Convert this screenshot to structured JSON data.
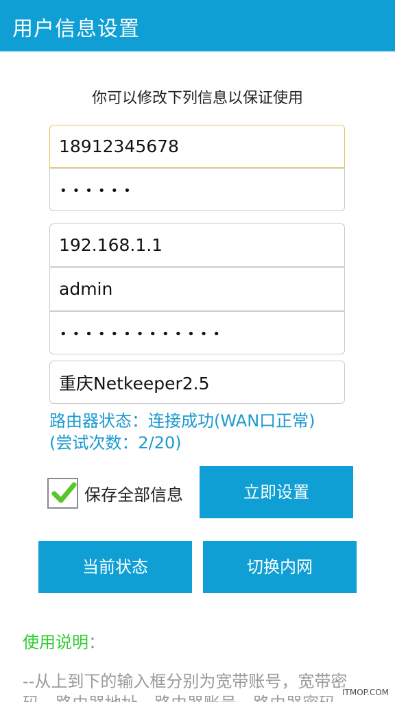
{
  "header": {
    "title": "用户信息设置"
  },
  "subtitle": "你可以修改下列信息以保证使用",
  "fields": {
    "account": "18912345678",
    "account_password": "••••••",
    "router_address": "192.168.1.1",
    "router_account": "admin",
    "router_password": "•••••••••••••",
    "mode": "重庆Netkeeper2.5"
  },
  "status": {
    "text": "路由器状态：连接成功(WAN口正常)(尝试次数：2/20)"
  },
  "save_all": {
    "label": "保存全部信息",
    "checked": true
  },
  "buttons": {
    "set_now": "立即设置",
    "current_status": "当前状态",
    "switch_lan": "切换内网"
  },
  "usage": {
    "title": "使用说明",
    "colon": "：",
    "text": "--从上到下的输入框分别为宽带账号，宽带密码，路由器地址，路由器账号，路由器密码"
  },
  "watermark": "ITMOP.COM",
  "colors": {
    "accent": "#0f9fd4",
    "status": "#1a9ad0",
    "usage_title": "#2fcc2f",
    "check": "#58c62a"
  }
}
